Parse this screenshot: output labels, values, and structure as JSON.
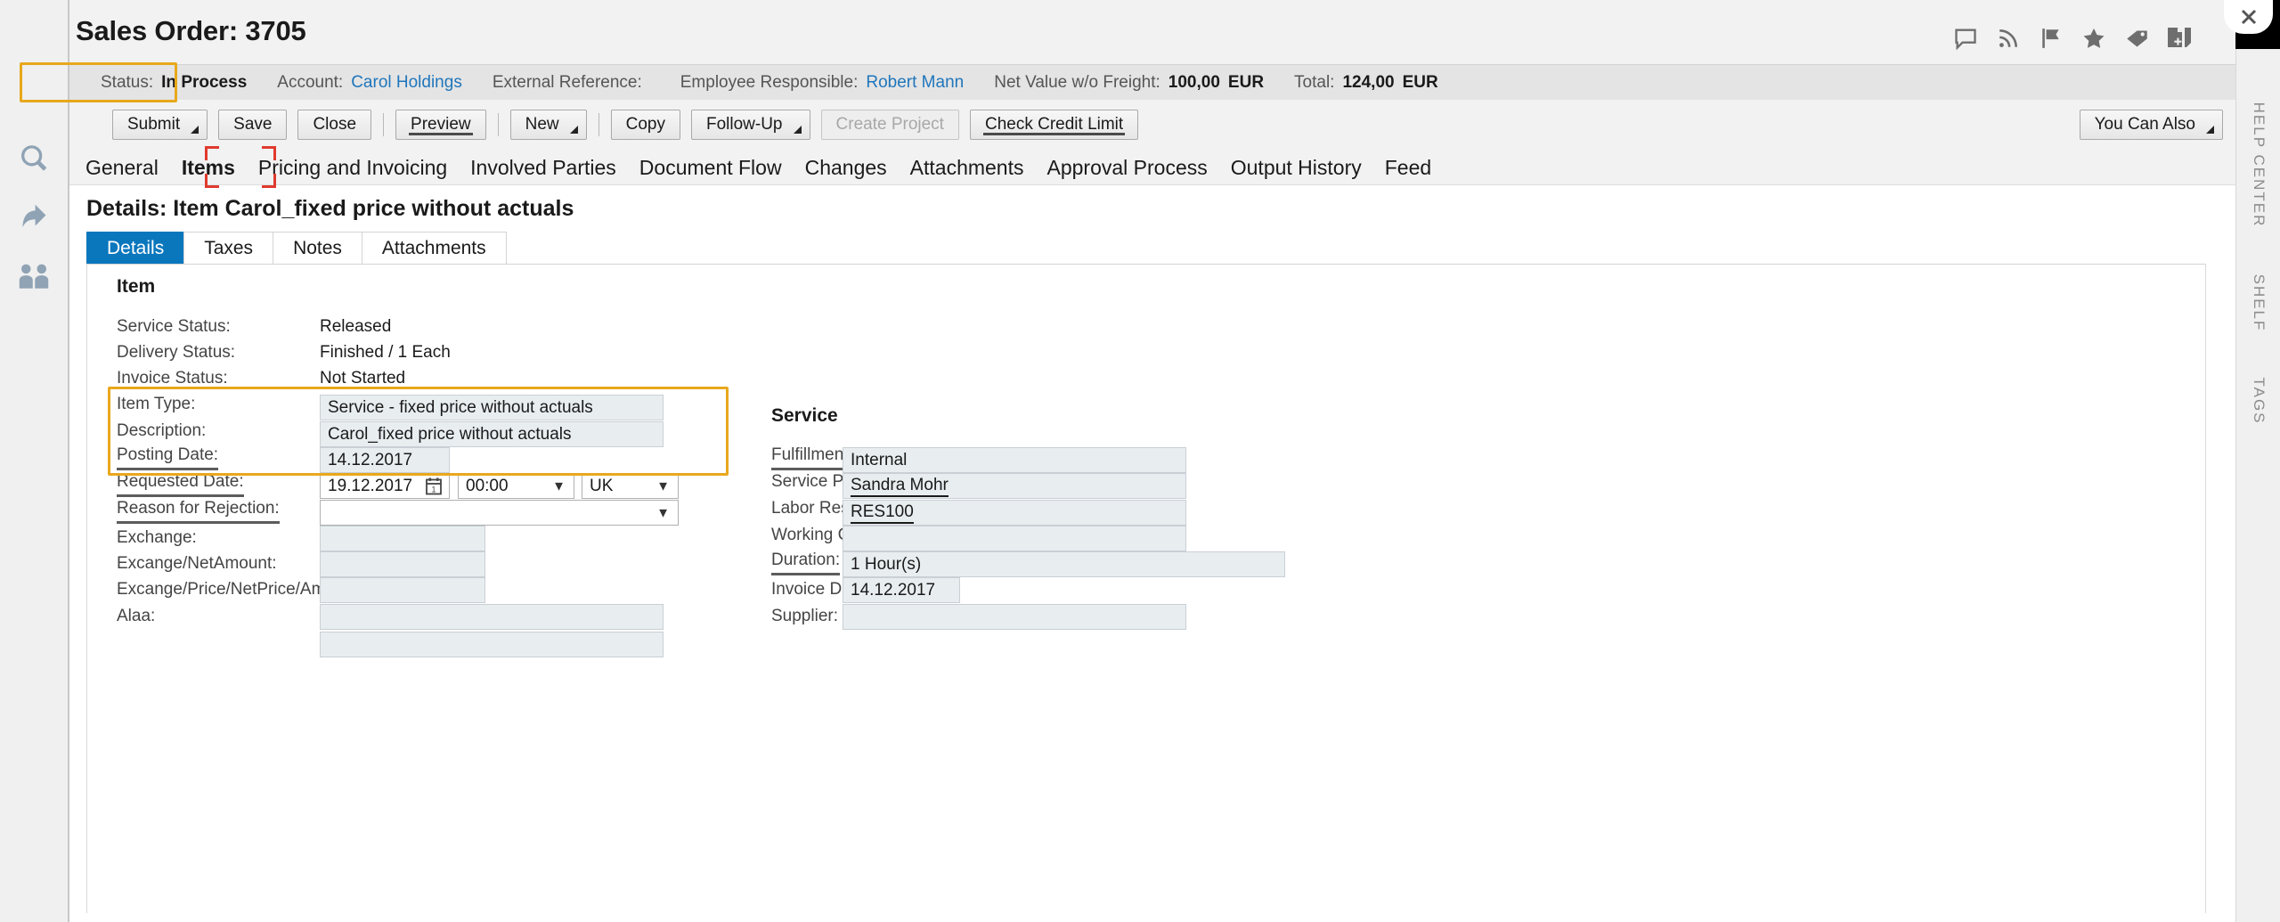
{
  "window": {
    "title": "Sales Order: 3705",
    "close_label": "✕"
  },
  "left_rail": {
    "items": [
      {
        "name": "search-icon",
        "label": "Search"
      },
      {
        "name": "share-icon",
        "label": "Share"
      },
      {
        "name": "people-icon",
        "label": "People"
      }
    ]
  },
  "header_icons": [
    {
      "name": "chat-icon",
      "label": "Chat"
    },
    {
      "name": "feed-icon",
      "label": "Feed"
    },
    {
      "name": "flag-icon",
      "label": "Flag"
    },
    {
      "name": "star-icon",
      "label": "Favorite"
    },
    {
      "name": "tag-icon",
      "label": "Tag"
    },
    {
      "name": "add-document-icon",
      "label": "Add Document"
    }
  ],
  "status_bar": {
    "status_label": "Status:",
    "status_value": "In Process",
    "account_label": "Account:",
    "account_value": "Carol Holdings",
    "external_reference_label": "External Reference:",
    "external_reference_value": "",
    "employee_responsible_label": "Employee Responsible:",
    "employee_responsible_value": "Robert Mann",
    "net_value_label": "Net Value w/o Freight:",
    "net_value_amount": "100,00",
    "net_value_currency": "EUR",
    "total_label": "Total:",
    "total_amount": "124,00",
    "total_currency": "EUR"
  },
  "toolbar": {
    "buttons": [
      {
        "label": "Submit",
        "caret": true,
        "disabled": false,
        "underline": false
      },
      {
        "label": "Save",
        "caret": false,
        "disabled": false,
        "underline": false
      },
      {
        "label": "Close",
        "caret": false,
        "disabled": false,
        "underline": false
      },
      {
        "label": "Preview",
        "caret": false,
        "disabled": false,
        "underline": true
      },
      {
        "label": "New",
        "caret": true,
        "disabled": false,
        "underline": false
      },
      {
        "label": "Copy",
        "caret": false,
        "disabled": false,
        "underline": false
      },
      {
        "label": "Follow-Up",
        "caret": true,
        "disabled": false,
        "underline": false
      },
      {
        "label": "Create Project",
        "caret": false,
        "disabled": true,
        "underline": false
      },
      {
        "label": "Check Credit Limit",
        "caret": false,
        "disabled": false,
        "underline": true
      }
    ],
    "you_can_also_label": "You Can Also"
  },
  "tabs": [
    {
      "label": "General",
      "active": false
    },
    {
      "label": "Items",
      "active": true
    },
    {
      "label": "Pricing and Invoicing",
      "active": false
    },
    {
      "label": "Involved Parties",
      "active": false
    },
    {
      "label": "Document Flow",
      "active": false
    },
    {
      "label": "Changes",
      "active": false
    },
    {
      "label": "Attachments",
      "active": false
    },
    {
      "label": "Approval Process",
      "active": false
    },
    {
      "label": "Output History",
      "active": false
    },
    {
      "label": "Feed",
      "active": false
    }
  ],
  "details": {
    "heading": "Details: Item Carol_fixed price without actuals",
    "subtabs": [
      {
        "label": "Details",
        "active": true
      },
      {
        "label": "Taxes",
        "active": false
      },
      {
        "label": "Notes",
        "active": false
      },
      {
        "label": "Attachments",
        "active": false
      }
    ]
  },
  "item_group": {
    "title": "Item",
    "service_status_label": "Service Status:",
    "service_status_value": "Released",
    "delivery_status_label": "Delivery Status:",
    "delivery_status_value": "Finished / 1 Each",
    "invoice_status_label": "Invoice Status:",
    "invoice_status_value": "Not Started",
    "item_type_label": "Item Type:",
    "item_type_value": "Service - fixed price without actuals",
    "description_label": "Description:",
    "description_value": "Carol_fixed price without actuals",
    "posting_date_label": "Posting Date:",
    "posting_date_value": "14.12.2017",
    "requested_date_label": "Requested Date:",
    "requested_date_value": "19.12.2017",
    "requested_time_value": "00:00",
    "requested_zone_value": "UK",
    "reason_for_rejection_label": "Reason for Rejection:",
    "reason_for_rejection_value": "",
    "exchange_label": "Exchange:",
    "exchange_value": "",
    "exchange_netamount_label": "Excange/NetAmount:",
    "exchange_netamount_value": "",
    "exchange_price_label": "Excange/Price/NetPrice/Amount:",
    "exchange_price_value": "",
    "alaa_label": "Alaa:",
    "alaa_value": ""
  },
  "service_group": {
    "title": "Service",
    "fulfillment_label": "Fulfillment:",
    "fulfillment_value": "Internal",
    "service_performer_label": "Service Performer:",
    "service_performer_value": "Sandra Mohr",
    "labor_resource_label": "Labor Resource:",
    "labor_resource_value": "RES100",
    "working_condition_label": "Working Condition:",
    "working_condition_value": "",
    "duration_label": "Duration:",
    "duration_value": "1 Hour(s)",
    "invoice_date_label": "Invoice Date:",
    "invoice_date_value": "14.12.2017",
    "supplier_label": "Supplier:",
    "supplier_value": ""
  },
  "right_rail": {
    "items": [
      {
        "label": "HELP CENTER"
      },
      {
        "label": "SHELF"
      },
      {
        "label": "TAGS"
      }
    ]
  },
  "colors": {
    "accent_blue": "#0a77bd",
    "link_blue": "#1f76bc",
    "highlight_orange": "#e8a81c",
    "marker_red": "#e03a2f",
    "field_bg": "#e8edf0"
  }
}
